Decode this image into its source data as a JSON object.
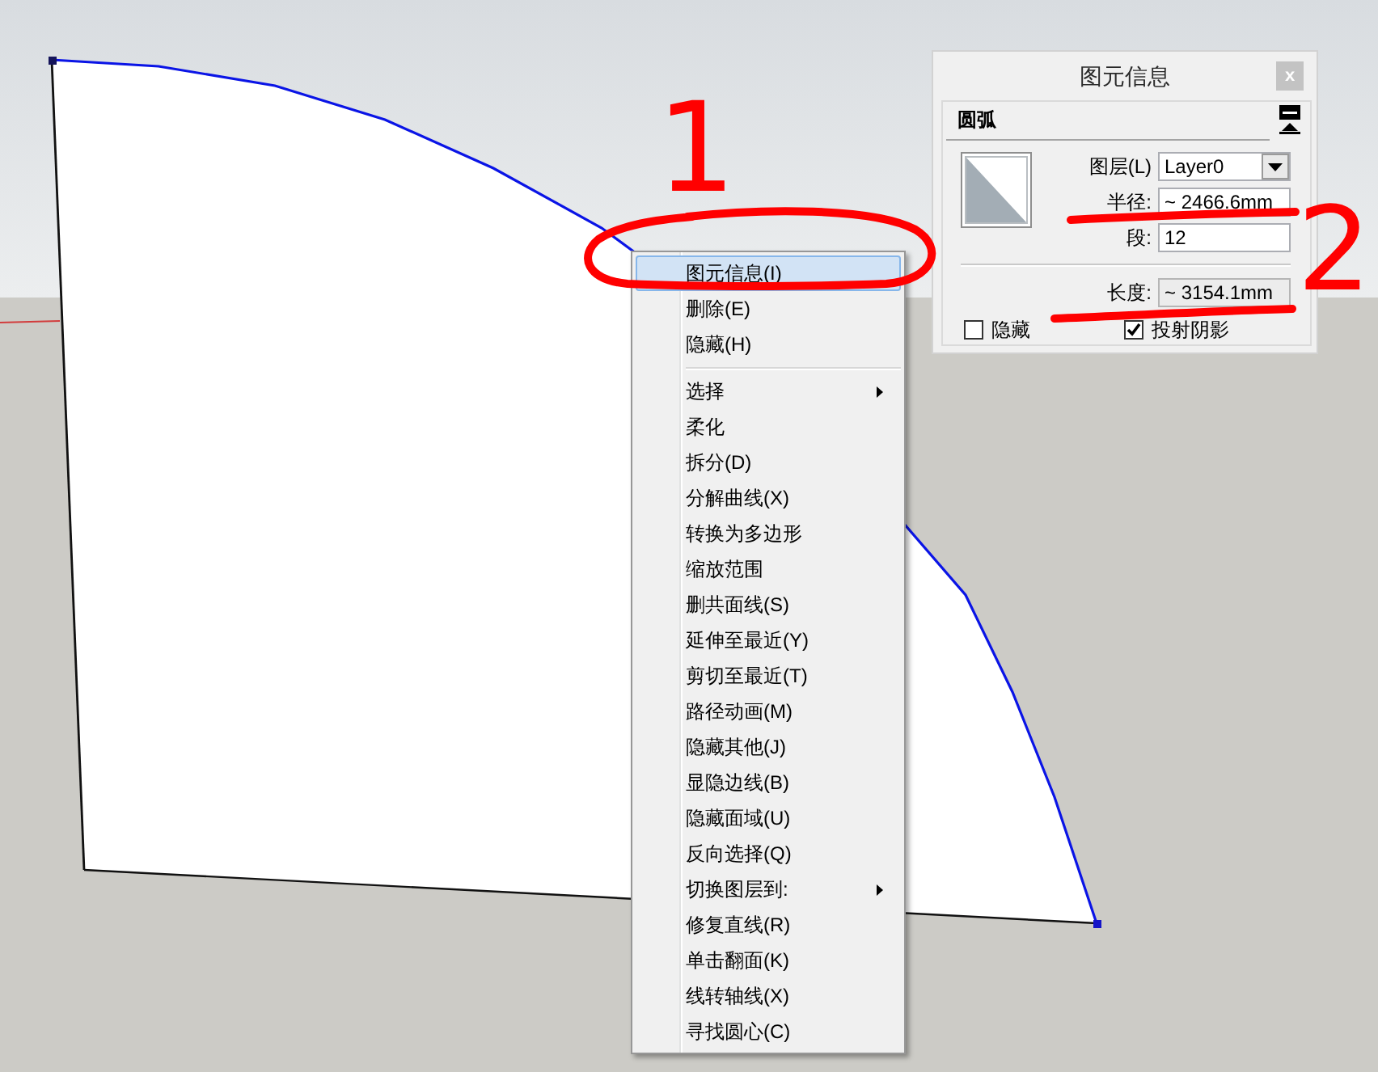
{
  "entity_info": {
    "title": "图元信息",
    "close_label": "x",
    "section_title": "圆弧",
    "fields": [
      {
        "kind": "dropdown",
        "label": "图层(L)",
        "value": "Layer0"
      },
      {
        "kind": "input",
        "label": "半径:",
        "value": "~ 2466.6mm"
      },
      {
        "kind": "input",
        "label": "段:",
        "value": "12"
      }
    ],
    "measurements": [
      {
        "kind": "readonly",
        "label": "长度:",
        "value": "~ 3154.1mm"
      }
    ],
    "checkboxes": [
      {
        "label": "隐藏",
        "checked": false
      },
      {
        "label": "投射阴影",
        "checked": true
      }
    ]
  },
  "annotations": [
    {
      "label": "1"
    },
    {
      "label": "2"
    }
  ],
  "context_menu": {
    "groups": [
      {
        "items": [
          {
            "label": "图元信息(I)",
            "selected": true,
            "submenu": false
          },
          {
            "label": "删除(E)",
            "selected": false,
            "submenu": false
          },
          {
            "label": "隐藏(H)",
            "selected": false,
            "submenu": false
          }
        ]
      },
      {
        "items": [
          {
            "label": "选择",
            "selected": false,
            "submenu": true
          },
          {
            "label": "柔化",
            "selected": false,
            "submenu": false
          },
          {
            "label": "拆分(D)",
            "selected": false,
            "submenu": false
          },
          {
            "label": "分解曲线(X)",
            "selected": false,
            "submenu": false
          },
          {
            "label": "转换为多边形",
            "selected": false,
            "submenu": false
          },
          {
            "label": "缩放范围",
            "selected": false,
            "submenu": false
          },
          {
            "label": "删共面线(S)",
            "selected": false,
            "submenu": false
          },
          {
            "label": "延伸至最近(Y)",
            "selected": false,
            "submenu": false
          },
          {
            "label": "剪切至最近(T)",
            "selected": false,
            "submenu": false
          },
          {
            "label": "路径动画(M)",
            "selected": false,
            "submenu": false
          },
          {
            "label": "隐藏其他(J)",
            "selected": false,
            "submenu": false
          },
          {
            "label": "显隐边线(B)",
            "selected": false,
            "submenu": false
          },
          {
            "label": "隐藏面域(U)",
            "selected": false,
            "submenu": false
          },
          {
            "label": "反向选择(Q)",
            "selected": false,
            "submenu": false
          },
          {
            "label": "切换图层到:",
            "selected": false,
            "submenu": true
          },
          {
            "label": "修复直线(R)",
            "selected": false,
            "submenu": false
          },
          {
            "label": "单击翻面(K)",
            "selected": false,
            "submenu": false
          },
          {
            "label": "线转轴线(X)",
            "selected": false,
            "submenu": false
          },
          {
            "label": "寻找圆心(C)",
            "selected": false,
            "submenu": false
          }
        ]
      }
    ]
  }
}
